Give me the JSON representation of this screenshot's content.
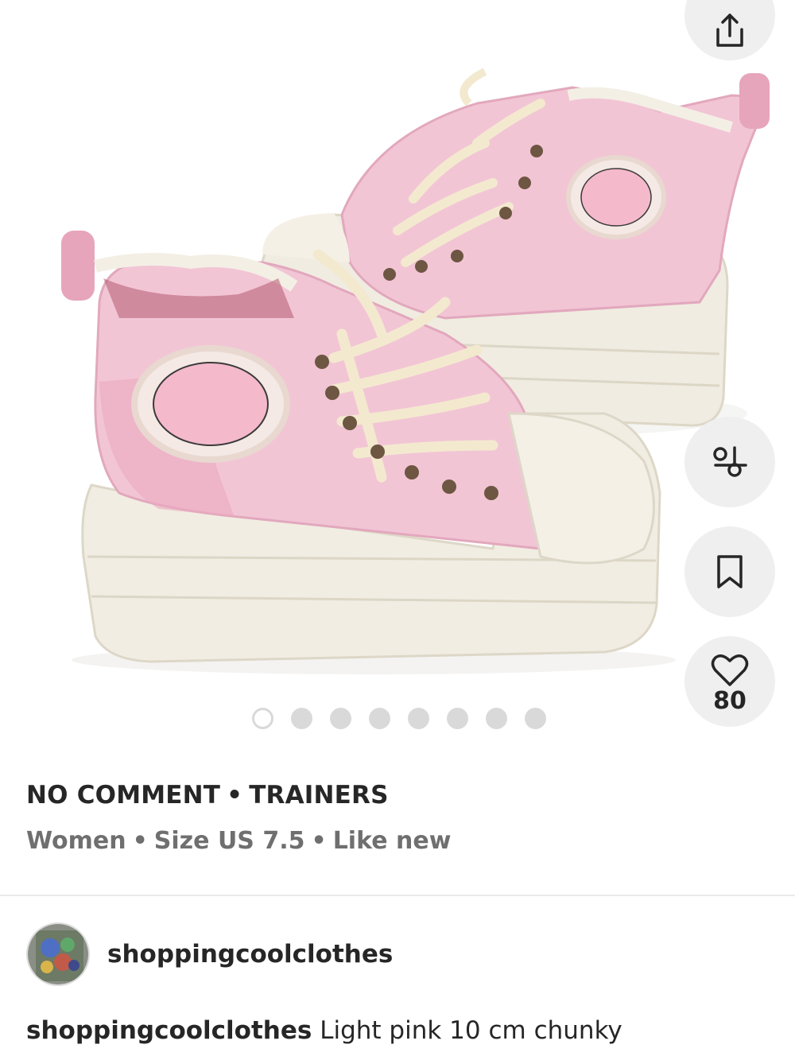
{
  "listing": {
    "brand": "NO COMMENT",
    "category": "TRAINERS",
    "separator": "•",
    "gender": "Women",
    "size": "Size US 7.5",
    "condition": "Like new",
    "like_count": "80"
  },
  "gallery": {
    "total_images": 8,
    "current_image": 1
  },
  "seller": {
    "username": "shoppingcoolclothes"
  },
  "description": {
    "username": "shoppingcoolclothes",
    "text": "Light pink 10 cm chunky"
  },
  "icons": {
    "share": "share-icon",
    "similar": "similar-items-icon",
    "save": "bookmark-icon",
    "like": "heart-icon"
  },
  "colors": {
    "text_primary": "#262626",
    "text_secondary": "#6f6f6f",
    "button_bg": "#efefef",
    "dot_inactive": "#d9d9d9",
    "product_pink": "#f2c3d3",
    "product_sole": "#f1ede2"
  }
}
